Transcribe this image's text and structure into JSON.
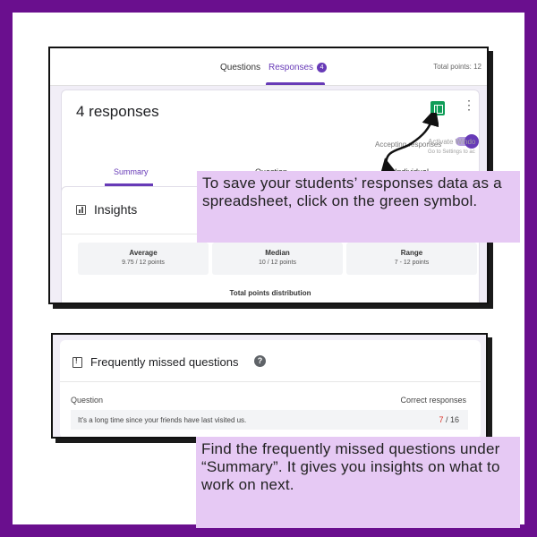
{
  "colors": {
    "frame": "#6a0f8e",
    "accent": "#673ab7",
    "sheets_green": "#0f9d58",
    "callout_bg": "#e6c9f4"
  },
  "top_screenshot": {
    "tabs": [
      {
        "label": "Questions"
      },
      {
        "label": "Responses",
        "badge": "4",
        "active": true
      }
    ],
    "total_points": "Total points: 12",
    "responses_card": {
      "title": "4 responses",
      "sheets_icon": "google-sheets-icon",
      "more_icon": "more-vert-icon",
      "accepting_label": "Accepting responses",
      "accepting_on": true,
      "subtabs": [
        "Summary",
        "Question",
        "Individual"
      ]
    },
    "insights": {
      "title": "Insights",
      "icon": "bar-chart-icon",
      "stats": [
        {
          "label": "Average",
          "value": "9.75 / 12 points"
        },
        {
          "label": "Median",
          "value": "10 / 12 points"
        },
        {
          "label": "Range",
          "value": "7 - 12 points"
        }
      ],
      "distribution_label": "Total points distribution",
      "watermark_line1": "Activate Windo",
      "watermark_line2": "Go to Settings to ac"
    }
  },
  "bottom_screenshot": {
    "title": "Frequently missed questions",
    "icon": "report-icon",
    "help_icon": "help-icon",
    "help_glyph": "?",
    "col_question": "Question",
    "col_correct": "Correct responses",
    "rows": [
      {
        "question": "It's a long time since your friends have last visited us.",
        "correct": "7",
        "total": " / 16"
      }
    ]
  },
  "callouts": {
    "spreadsheet": "To save your students’ responses data as a spreadsheet, click on the green symbol.",
    "summary": "Find the frequently missed questions under “Summary”. It gives you insights on what to work on next."
  }
}
